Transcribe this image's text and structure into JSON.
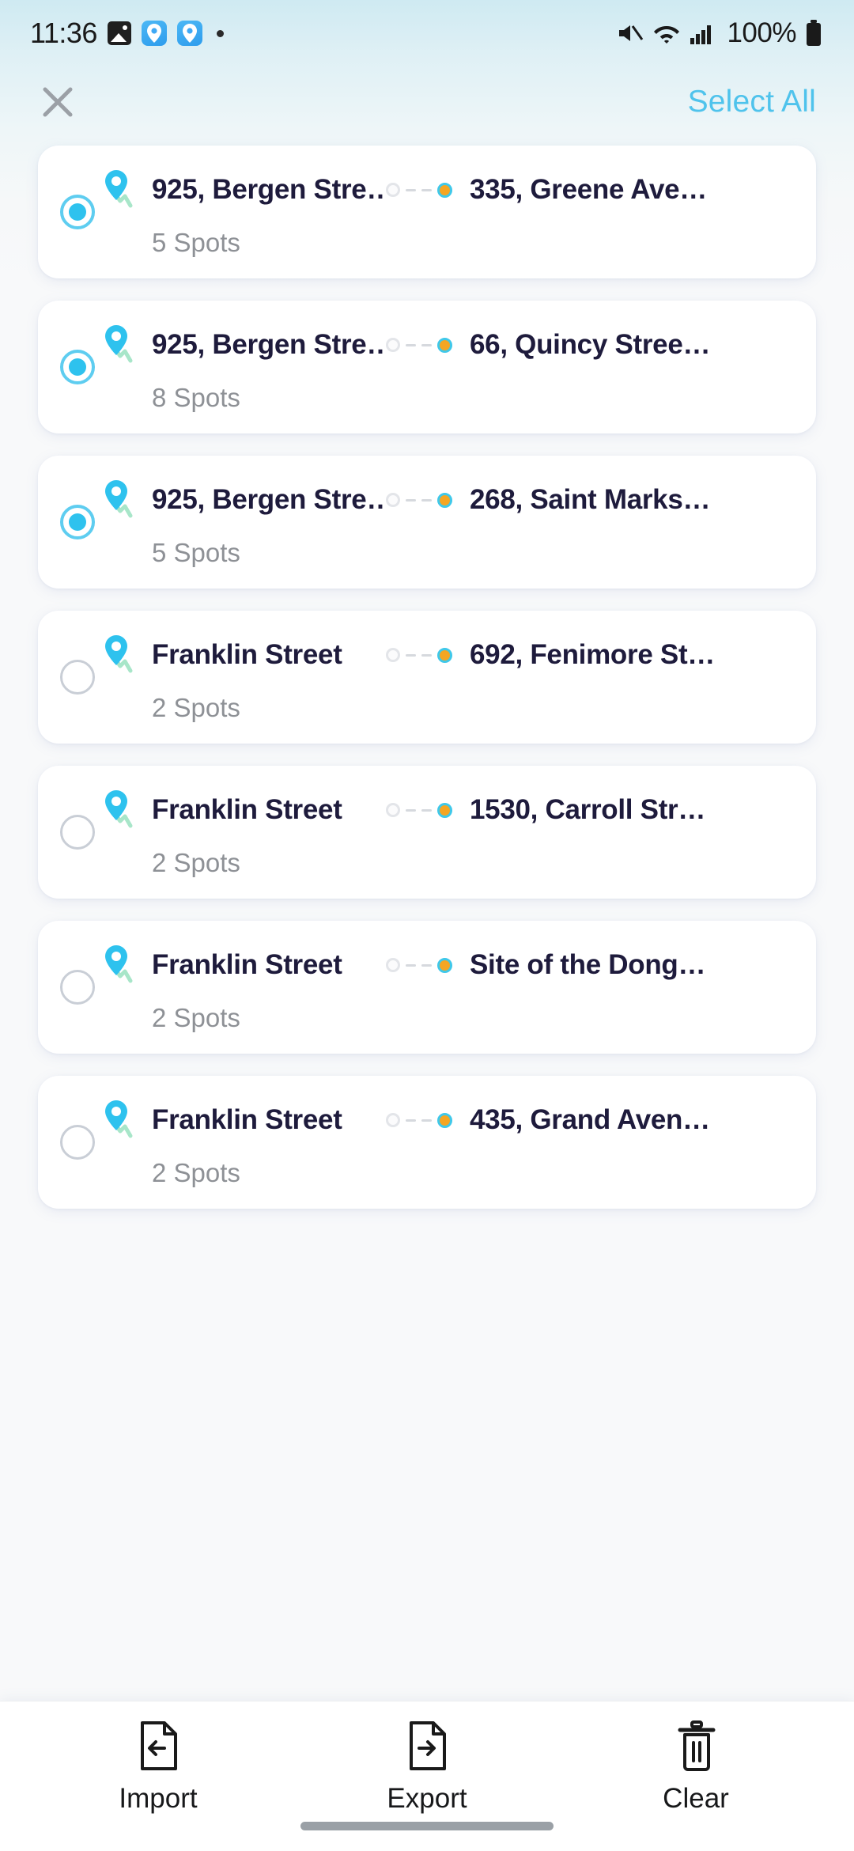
{
  "status_bar": {
    "time": "11:36",
    "icons": [
      "gallery-icon",
      "map-app-icon",
      "map-app-icon",
      "notification-dot"
    ],
    "mute_icon": "mute-icon",
    "wifi_icon": "wifi-icon",
    "signal_icon": "cellular-signal-icon",
    "battery_percent": "100%",
    "battery_icon": "battery-full-icon"
  },
  "header": {
    "close_icon": "close-icon",
    "select_all_label": "Select All"
  },
  "colors": {
    "accent_cyan": "#4fc3ec",
    "pin_cyan": "#2ec2ee",
    "destination_orange": "#f5a623",
    "text_navy": "#1e1b3c",
    "muted_gray": "#8e9196"
  },
  "routes": [
    {
      "selected": true,
      "origin": "925, Bergen Stre…",
      "destination": "335, Greene Ave…",
      "spots": "5 Spots"
    },
    {
      "selected": true,
      "origin": "925, Bergen Stre…",
      "destination": "66, Quincy Stree…",
      "spots": "8 Spots"
    },
    {
      "selected": true,
      "origin": "925, Bergen Stre…",
      "destination": "268, Saint Marks…",
      "spots": "5 Spots"
    },
    {
      "selected": false,
      "origin": "Franklin Street",
      "destination": "692, Fenimore St…",
      "spots": "2 Spots"
    },
    {
      "selected": false,
      "origin": "Franklin Street",
      "destination": "1530, Carroll Str…",
      "spots": "2 Spots"
    },
    {
      "selected": false,
      "origin": "Franklin Street",
      "destination": "Site of the Dong…",
      "spots": "2 Spots"
    },
    {
      "selected": false,
      "origin": "Franklin Street",
      "destination": "435, Grand Aven…",
      "spots": "2 Spots"
    }
  ],
  "bottom_bar": {
    "import_label": "Import",
    "export_label": "Export",
    "clear_label": "Clear"
  }
}
